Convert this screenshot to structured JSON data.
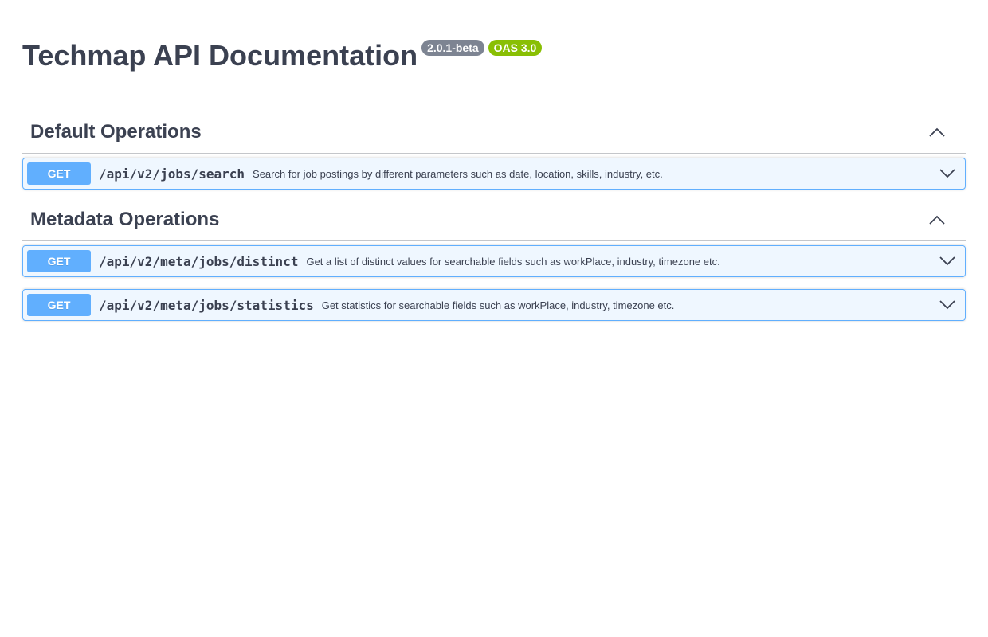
{
  "info": {
    "title": "Techmap API Documentation",
    "version_badge": "2.0.1-beta",
    "oas_badge": "OAS 3.0"
  },
  "sections": [
    {
      "name": "Default Operations",
      "toggle_icon": "chevron-up-icon",
      "operations": [
        {
          "method": "GET",
          "path": "/api/v2/jobs/search",
          "summary": "Search for job postings by different parameters such as date, location, skills, industry, etc.",
          "toggle_icon": "chevron-down-icon"
        }
      ]
    },
    {
      "name": "Metadata Operations",
      "toggle_icon": "chevron-up-icon",
      "operations": [
        {
          "method": "GET",
          "path": "/api/v2/meta/jobs/distinct",
          "summary": "Get a list of distinct values for searchable fields such as workPlace, industry, timezone etc.",
          "toggle_icon": "chevron-down-icon"
        },
        {
          "method": "GET",
          "path": "/api/v2/meta/jobs/statistics",
          "summary": "Get statistics for searchable fields such as workPlace, industry, timezone etc.",
          "toggle_icon": "chevron-down-icon"
        }
      ]
    }
  ],
  "colors": {
    "get_method": "#61affe",
    "version_badge": "#7d8492",
    "oas_badge": "#89bf04",
    "text": "#3b4151"
  }
}
